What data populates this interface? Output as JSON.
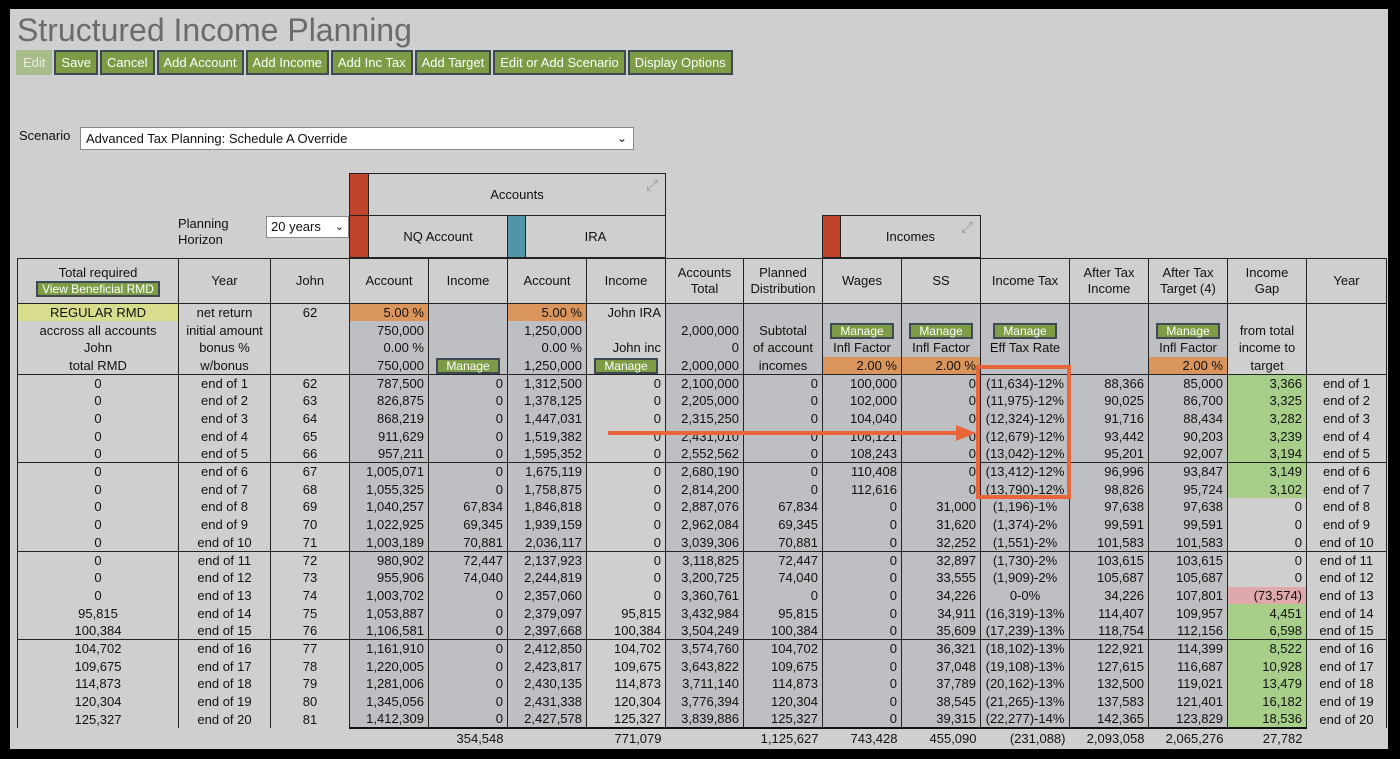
{
  "title": "Structured Income Planning",
  "toolbar": {
    "buttons": [
      {
        "label": "Edit",
        "disabled": true
      },
      {
        "label": "Save"
      },
      {
        "label": "Cancel"
      },
      {
        "label": "Add Account"
      },
      {
        "label": "Add Income"
      },
      {
        "label": "Add Inc Tax"
      },
      {
        "label": "Add Target"
      },
      {
        "label": "Edit or Add Scenario"
      },
      {
        "label": "Display Options"
      }
    ]
  },
  "scenario": {
    "label": "Scenario",
    "value": "Advanced Tax Planning: Schedule A Override"
  },
  "planning_horizon": {
    "label_line1": "Planning",
    "label_line2": "Horizon",
    "value": "20 years"
  },
  "groups": {
    "accounts": "Accounts",
    "nq_account": "NQ Account",
    "ira": "IRA",
    "incomes": "Incomes"
  },
  "colors": {
    "account_swatch": "#c0432c",
    "ira_swatch": "#4f97a8",
    "button": "#7d9c45",
    "highlight": "#e8663a"
  },
  "headers": {
    "total_required": "Total required",
    "view_beneficial_rmd": "View Beneficial RMD",
    "year": "Year",
    "john": "John",
    "account": "Account",
    "income": "Income",
    "accounts_total_1": "Accounts",
    "accounts_total_2": "Total",
    "planned_1": "Planned",
    "planned_2": "Distribution",
    "wages": "Wages",
    "ss": "SS",
    "income_tax": "Income Tax",
    "after_tax_1": "After Tax",
    "after_tax_2": "Income",
    "after_target_1": "After Tax",
    "after_target_2": "Target (4)",
    "gap_1": "Income",
    "gap_2": "Gap",
    "year_right": "Year"
  },
  "params": {
    "regular_rmd": "REGULAR RMD",
    "across": "accross all accounts",
    "john": "John",
    "total_rmd": "total RMD",
    "net_return": "net return",
    "initial_amount": "initial amount",
    "bonus_pct": "bonus %",
    "w_bonus": "w/bonus",
    "age": "62",
    "nq_rate": "5.00  %",
    "nq_initial": "750,000",
    "nq_bonus": "0.00  %",
    "nq_wbonus": "750,000",
    "ira_rate": "5.00  %",
    "ira_initial": "1,250,000",
    "ira_bonus": "0.00  %",
    "ira_wbonus": "1,250,000",
    "john_ira": "John IRA",
    "john_inc": "John inc",
    "acct_total_initial": "2,000,000",
    "acct_total_zero": "0",
    "acct_total_wbonus": "2,000,000",
    "subtotal": "Subtotal",
    "of_account": "of account",
    "incomes_word": "incomes",
    "manage": "Manage",
    "infl_factor": "Infl Factor",
    "wages_infl": "2.00  %",
    "ss_infl": "2.00  %",
    "eff_tax_rate": "Eff Tax Rate",
    "target_infl": "2.00  %",
    "from_total": "from total",
    "income_to": "income to",
    "target": "target"
  },
  "rows": [
    [
      "0",
      "end of 1",
      "62",
      "787,500",
      "0",
      "1,312,500",
      "0",
      "2,100,000",
      "0",
      "100,000",
      "0",
      "(11,634)-12%",
      "88,366",
      "85,000",
      "3,366",
      "end of 1"
    ],
    [
      "0",
      "end of 2",
      "63",
      "826,875",
      "0",
      "1,378,125",
      "0",
      "2,205,000",
      "0",
      "102,000",
      "0",
      "(11,975)-12%",
      "90,025",
      "86,700",
      "3,325",
      "end of 2"
    ],
    [
      "0",
      "end of 3",
      "64",
      "868,219",
      "0",
      "1,447,031",
      "0",
      "2,315,250",
      "0",
      "104,040",
      "0",
      "(12,324)-12%",
      "91,716",
      "88,434",
      "3,282",
      "end of 3"
    ],
    [
      "0",
      "end of 4",
      "65",
      "911,629",
      "0",
      "1,519,382",
      "0",
      "2,431,010",
      "0",
      "106,121",
      "0",
      "(12,679)-12%",
      "93,442",
      "90,203",
      "3,239",
      "end of 4"
    ],
    [
      "0",
      "end of 5",
      "66",
      "957,211",
      "0",
      "1,595,352",
      "0",
      "2,552,562",
      "0",
      "108,243",
      "0",
      "(13,042)-12%",
      "95,201",
      "92,007",
      "3,194",
      "end of 5"
    ],
    [
      "0",
      "end of 6",
      "67",
      "1,005,071",
      "0",
      "1,675,119",
      "0",
      "2,680,190",
      "0",
      "110,408",
      "0",
      "(13,412)-12%",
      "96,996",
      "93,847",
      "3,149",
      "end of 6"
    ],
    [
      "0",
      "end of 7",
      "68",
      "1,055,325",
      "0",
      "1,758,875",
      "0",
      "2,814,200",
      "0",
      "112,616",
      "0",
      "(13,790)-12%",
      "98,826",
      "95,724",
      "3,102",
      "end of 7"
    ],
    [
      "0",
      "end of 8",
      "69",
      "1,040,257",
      "67,834",
      "1,846,818",
      "0",
      "2,887,076",
      "67,834",
      "0",
      "31,000",
      "(1,196)-1%",
      "97,638",
      "97,638",
      "0",
      "end of 8"
    ],
    [
      "0",
      "end of 9",
      "70",
      "1,022,925",
      "69,345",
      "1,939,159",
      "0",
      "2,962,084",
      "69,345",
      "0",
      "31,620",
      "(1,374)-2%",
      "99,591",
      "99,591",
      "0",
      "end of 9"
    ],
    [
      "0",
      "end of 10",
      "71",
      "1,003,189",
      "70,881",
      "2,036,117",
      "0",
      "3,039,306",
      "70,881",
      "0",
      "32,252",
      "(1,551)-2%",
      "101,583",
      "101,583",
      "0",
      "end of 10"
    ],
    [
      "0",
      "end of 11",
      "72",
      "980,902",
      "72,447",
      "2,137,923",
      "0",
      "3,118,825",
      "72,447",
      "0",
      "32,897",
      "(1,730)-2%",
      "103,615",
      "103,615",
      "0",
      "end of 11"
    ],
    [
      "0",
      "end of 12",
      "73",
      "955,906",
      "74,040",
      "2,244,819",
      "0",
      "3,200,725",
      "74,040",
      "0",
      "33,555",
      "(1,909)-2%",
      "105,687",
      "105,687",
      "0",
      "end of 12"
    ],
    [
      "0",
      "end of 13",
      "74",
      "1,003,702",
      "0",
      "2,357,060",
      "0",
      "3,360,761",
      "0",
      "0",
      "34,226",
      "0-0%",
      "34,226",
      "107,801",
      "(73,574)",
      "end of 13"
    ],
    [
      "95,815",
      "end of 14",
      "75",
      "1,053,887",
      "0",
      "2,379,097",
      "95,815",
      "3,432,984",
      "95,815",
      "0",
      "34,911",
      "(16,319)-13%",
      "114,407",
      "109,957",
      "4,451",
      "end of 14"
    ],
    [
      "100,384",
      "end of 15",
      "76",
      "1,106,581",
      "0",
      "2,397,668",
      "100,384",
      "3,504,249",
      "100,384",
      "0",
      "35,609",
      "(17,239)-13%",
      "118,754",
      "112,156",
      "6,598",
      "end of 15"
    ],
    [
      "104,702",
      "end of 16",
      "77",
      "1,161,910",
      "0",
      "2,412,850",
      "104,702",
      "3,574,760",
      "104,702",
      "0",
      "36,321",
      "(18,102)-13%",
      "122,921",
      "114,399",
      "8,522",
      "end of 16"
    ],
    [
      "109,675",
      "end of 17",
      "78",
      "1,220,005",
      "0",
      "2,423,817",
      "109,675",
      "3,643,822",
      "109,675",
      "0",
      "37,048",
      "(19,108)-13%",
      "127,615",
      "116,687",
      "10,928",
      "end of 17"
    ],
    [
      "114,873",
      "end of 18",
      "79",
      "1,281,006",
      "0",
      "2,430,135",
      "114,873",
      "3,711,140",
      "114,873",
      "0",
      "37,789",
      "(20,162)-13%",
      "132,500",
      "119,021",
      "13,479",
      "end of 18"
    ],
    [
      "120,304",
      "end of 19",
      "80",
      "1,345,056",
      "0",
      "2,431,338",
      "120,304",
      "3,776,394",
      "120,304",
      "0",
      "38,545",
      "(21,265)-13%",
      "137,583",
      "121,401",
      "16,182",
      "end of 19"
    ],
    [
      "125,327",
      "end of 20",
      "81",
      "1,412,309",
      "0",
      "2,427,578",
      "125,327",
      "3,839,886",
      "125,327",
      "0",
      "39,315",
      "(22,277)-14%",
      "142,365",
      "123,829",
      "18,536",
      "end of 20"
    ]
  ],
  "totals": [
    "",
    "",
    "",
    "",
    "354,548",
    "",
    "771,079",
    "",
    "1,125,627",
    "743,428",
    "455,090",
    "(231,088)",
    "2,093,058",
    "2,065,276",
    "27,782",
    ""
  ]
}
